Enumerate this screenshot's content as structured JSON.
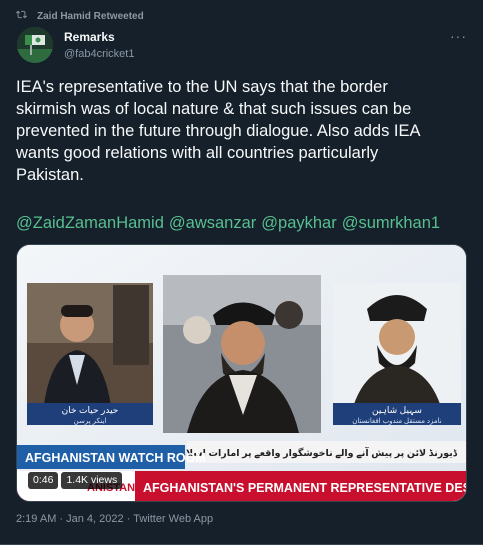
{
  "retweet": {
    "text": "Zaid Hamid Retweeted",
    "icon": "retweet-icon"
  },
  "author": {
    "name": "Remarks",
    "handle": "@fab4cricket1",
    "avatar_icon": "avatar-image"
  },
  "menu": {
    "icon": "more-icon",
    "label": "···"
  },
  "tweet": {
    "text": "IEA's representative to the UN says that the border\nskirmish was of local nature & that such issues can be\nprevented in the future through dialogue. Also adds IEA\nwants good relations with all countries particularly\nPakistan.",
    "mentions": [
      "@ZaidZamanHamid",
      "@awsanzar",
      "@paykhar",
      "@sumrkhan1"
    ]
  },
  "video": {
    "panel_left_name": "حیدر حیات خان",
    "panel_left_sub": "اینکر پرسن",
    "panel_right_name": "سہیل شاہین",
    "panel_right_sub": "نامزد مستقل مندوب افغانستان",
    "ticker_urdu": "ڈیورنڈ لائن پر پیش آنے والے ناخوشگوار واقعے پر امارات اسلامی افغانستان کا موقف",
    "show_title": "AFGHANISTAN WATCH ROOM",
    "banner_left": "ANISTAN",
    "banner_right": "AFGHANISTAN'S PERMANENT REPRESENTATIVE DESI",
    "duration": "0:46",
    "views": "1.4K views"
  },
  "meta": {
    "time": "2:19 AM · Jan 4, 2022 · Twitter Web App"
  },
  "colors": {
    "background": "#15202b",
    "mention": "#58bf8f",
    "muted": "#8b98a5",
    "banner_red": "#c8102e",
    "watch_blue": "#1f5fa8"
  }
}
